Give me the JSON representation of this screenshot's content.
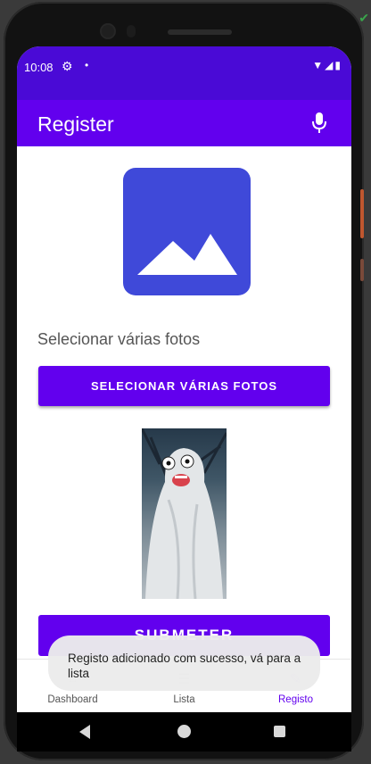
{
  "status_bar": {
    "time": "10:08",
    "icons": [
      "settings-icon",
      "notification-dot-icon",
      "wifi-icon",
      "signal-icon",
      "battery-icon"
    ]
  },
  "app_bar": {
    "title": "Register",
    "mic_icon": "mic-icon"
  },
  "form": {
    "image_placeholder_icon": "image-icon",
    "select_label": "Selecionar várias fotos",
    "select_button": "SELECIONAR VÁRIAS FOTOS",
    "submit_button": "SUBMETER"
  },
  "toast": {
    "message": "Registo adicionado com sucesso, vá para a lista"
  },
  "bottom_nav": {
    "items": [
      {
        "label": "Dashboard",
        "icon": "home-icon"
      },
      {
        "label": "Lista",
        "icon": "list-icon"
      },
      {
        "label": "Registo",
        "icon": "edit-note-icon",
        "active": true
      }
    ]
  },
  "colors": {
    "primary": "#6200ee",
    "status_bar": "#4a0ad6",
    "placeholder": "#3f49d9"
  }
}
